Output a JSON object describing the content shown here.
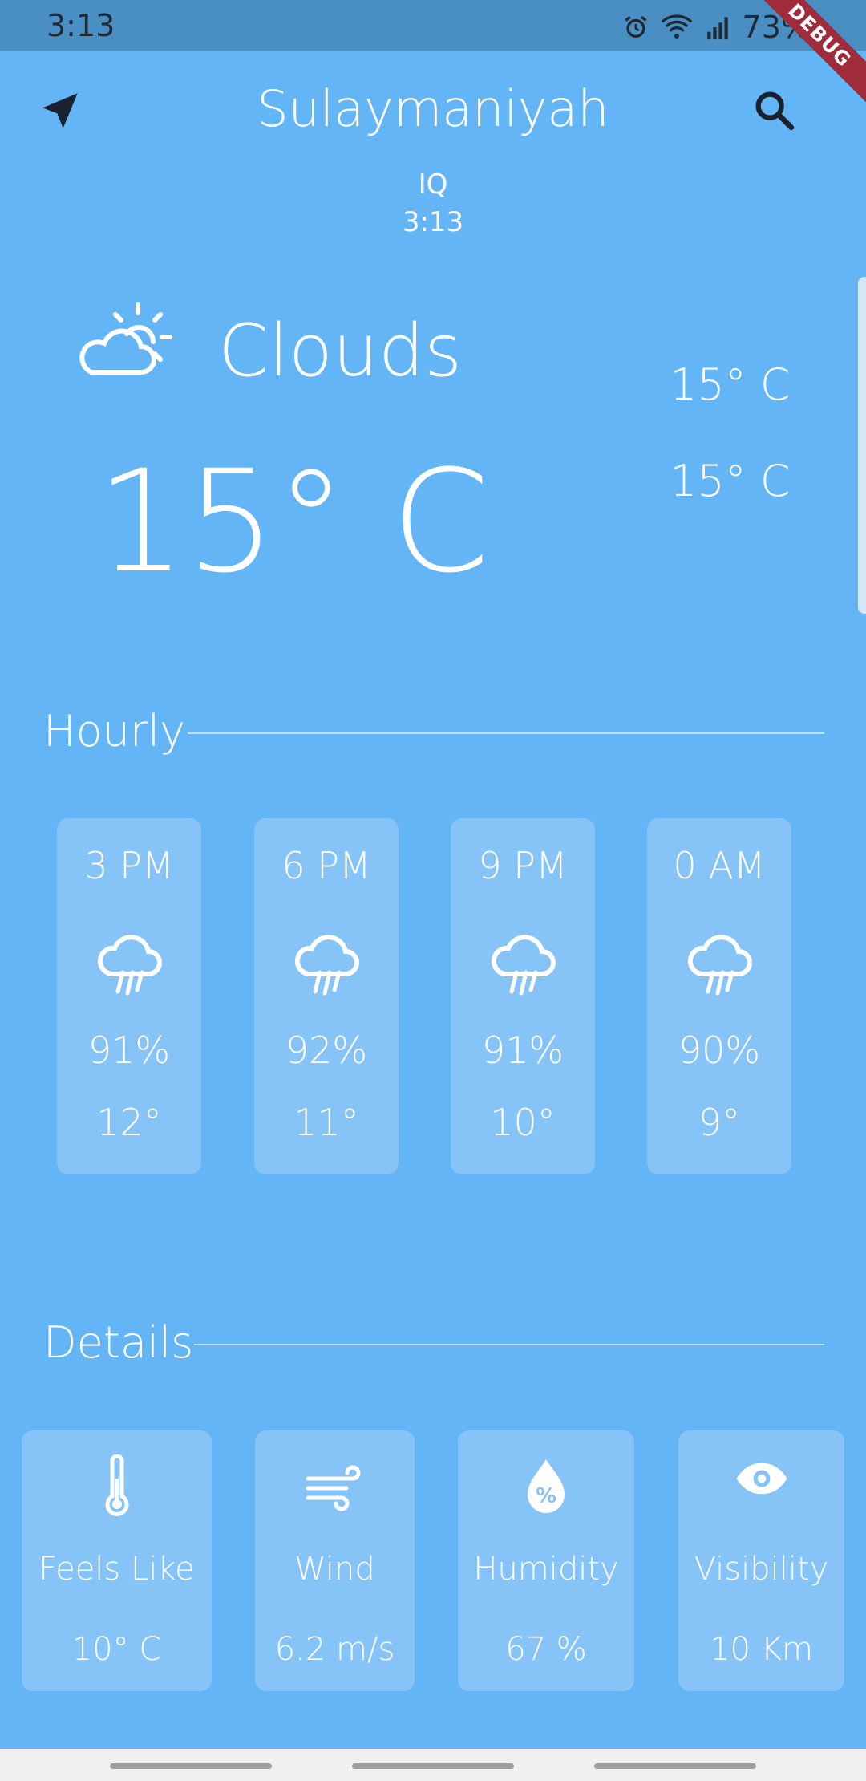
{
  "status_bar": {
    "time": "3:13",
    "battery": "73%",
    "debug_label": "DEBUG"
  },
  "header": {
    "city": "Sulaymaniyah",
    "country": "IQ",
    "local_time": "3:13"
  },
  "current": {
    "condition": "Clouds",
    "temp": "15° C",
    "temp_max": "15° C",
    "temp_min": "15° C"
  },
  "hourly": {
    "title": "Hourly",
    "items": [
      {
        "time": "3 PM",
        "pop": "91%",
        "temp": "12°",
        "icon": "rain-cloud-icon"
      },
      {
        "time": "6 PM",
        "pop": "92%",
        "temp": "11°",
        "icon": "rain-cloud-icon"
      },
      {
        "time": "9 PM",
        "pop": "91%",
        "temp": "10°",
        "icon": "rain-cloud-icon"
      },
      {
        "time": "0 AM",
        "pop": "90%",
        "temp": "9°",
        "icon": "rain-cloud-icon"
      }
    ]
  },
  "details": {
    "title": "Details",
    "items": [
      {
        "label": "Feels Like",
        "value": "10° C",
        "icon": "thermometer-icon"
      },
      {
        "label": "Wind",
        "value": "6.2 m/s",
        "icon": "wind-icon"
      },
      {
        "label": "Humidity",
        "value": "67 %",
        "icon": "humidity-drop-icon"
      },
      {
        "label": "Visibility",
        "value": "10 Km",
        "icon": "eye-icon"
      }
    ]
  },
  "colors": {
    "background": "#64b5f6",
    "card": "#86c3f7",
    "status_bar": "#4a8fc4",
    "text": "#ffffff"
  }
}
